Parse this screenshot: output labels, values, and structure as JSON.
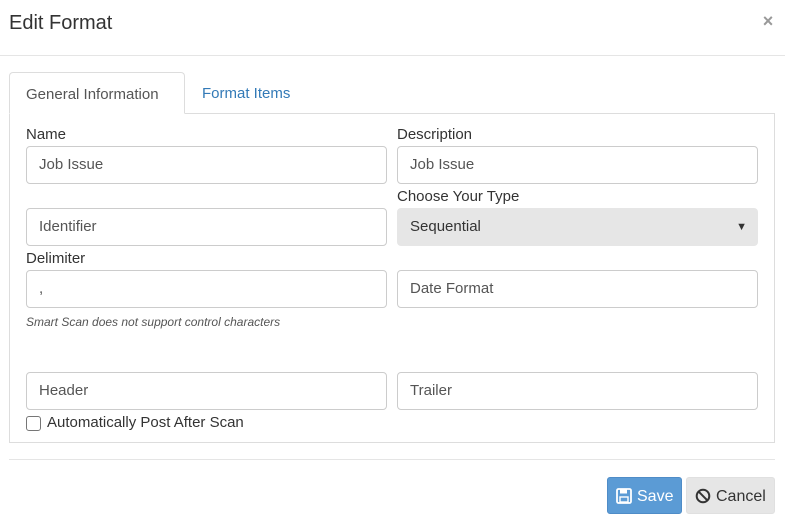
{
  "dialog": {
    "title": "Edit Format",
    "close_glyph": "×"
  },
  "tabs": [
    {
      "label": "General Information",
      "active": true
    },
    {
      "label": "Format Items",
      "active": false
    }
  ],
  "form": {
    "name_label": "Name",
    "name_value": "Job Issue",
    "description_label": "Description",
    "description_value": "Job Issue",
    "identifier_placeholder": "Identifier",
    "type_label": "Choose Your Type",
    "type_value": "Sequential",
    "delimiter_label": "Delimiter",
    "delimiter_value": ",",
    "date_format_placeholder": "Date Format",
    "delimiter_help": "Smart Scan does not support control characters",
    "header_placeholder": "Header",
    "trailer_placeholder": "Trailer",
    "auto_post_label": "Automatically Post After Scan",
    "auto_post_checked": false
  },
  "footer": {
    "save_label": "Save",
    "cancel_label": "Cancel"
  },
  "colors": {
    "primary": "#5b9bd5",
    "link": "#337ab7"
  }
}
